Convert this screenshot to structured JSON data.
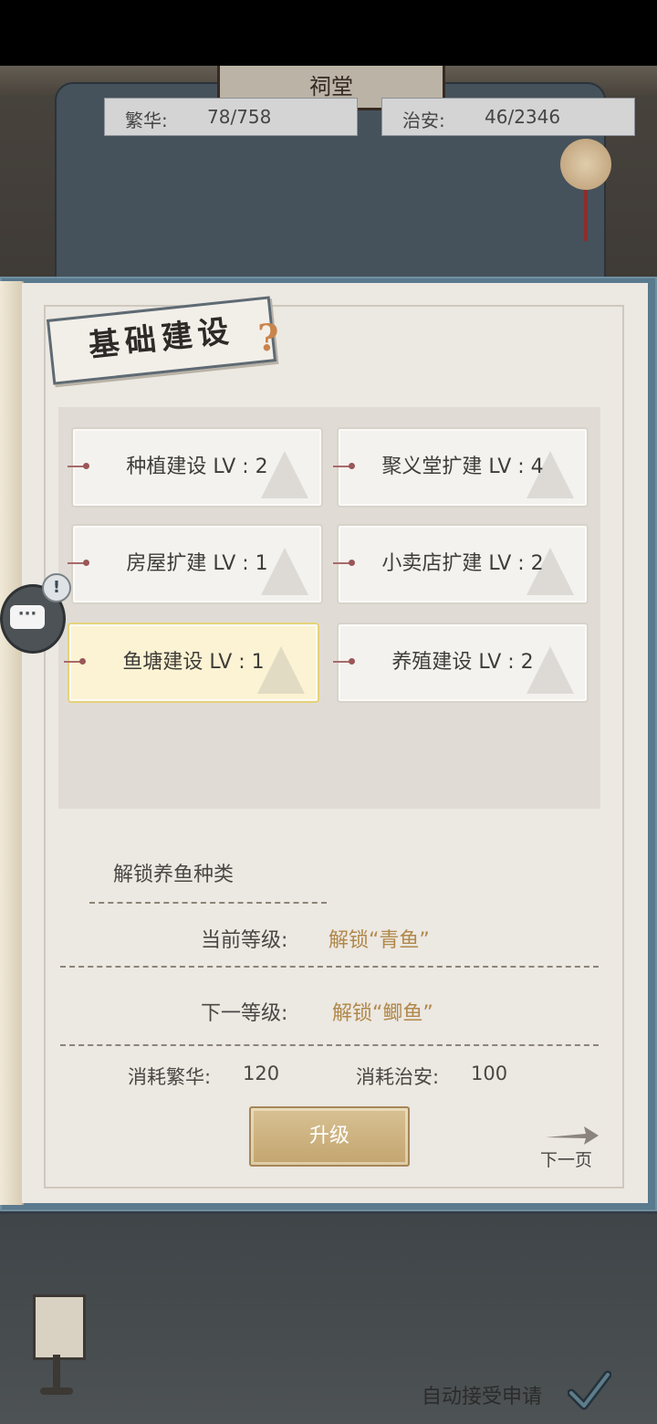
{
  "header": {
    "hall_name": "祠堂",
    "prosperity": {
      "label": "繁华:",
      "value": "78/758"
    },
    "security": {
      "label": "治安:",
      "value": "46/2346"
    }
  },
  "panel": {
    "title": "基础建设",
    "help_icon": "question-mark-icon",
    "buildings": [
      {
        "label": "种植建设 LV : 2",
        "selected": false
      },
      {
        "label": "聚义堂扩建 LV : 4",
        "selected": false
      },
      {
        "label": "房屋扩建 LV : 1",
        "selected": false
      },
      {
        "label": "小卖店扩建 LV : 2",
        "selected": false
      },
      {
        "label": "鱼塘建设 LV : 1",
        "selected": true
      },
      {
        "label": "养殖建设 LV : 2",
        "selected": false
      }
    ],
    "detail": {
      "title": "解锁养鱼种类",
      "current_label": "当前等级:",
      "current_value": "解锁“青鱼”",
      "next_label": "下一等级:",
      "next_value": "解锁“鲫鱼”",
      "cost_prosperity_label": "消耗繁华:",
      "cost_prosperity_value": "120",
      "cost_security_label": "消耗治安:",
      "cost_security_value": "100"
    },
    "upgrade_label": "升级",
    "next_page_label": "下一页"
  },
  "footer": {
    "auto_accept_label": "自动接受申请",
    "auto_accept_checked": true
  },
  "side": {
    "chat_icon": "chat-bubble-icon",
    "chat_alert": "!"
  },
  "colors": {
    "accent_gold": "#b1884a",
    "selected_card": "#fbf3d3",
    "upgrade_button": "#c8ab77",
    "book_frame": "#5a7a8e"
  }
}
